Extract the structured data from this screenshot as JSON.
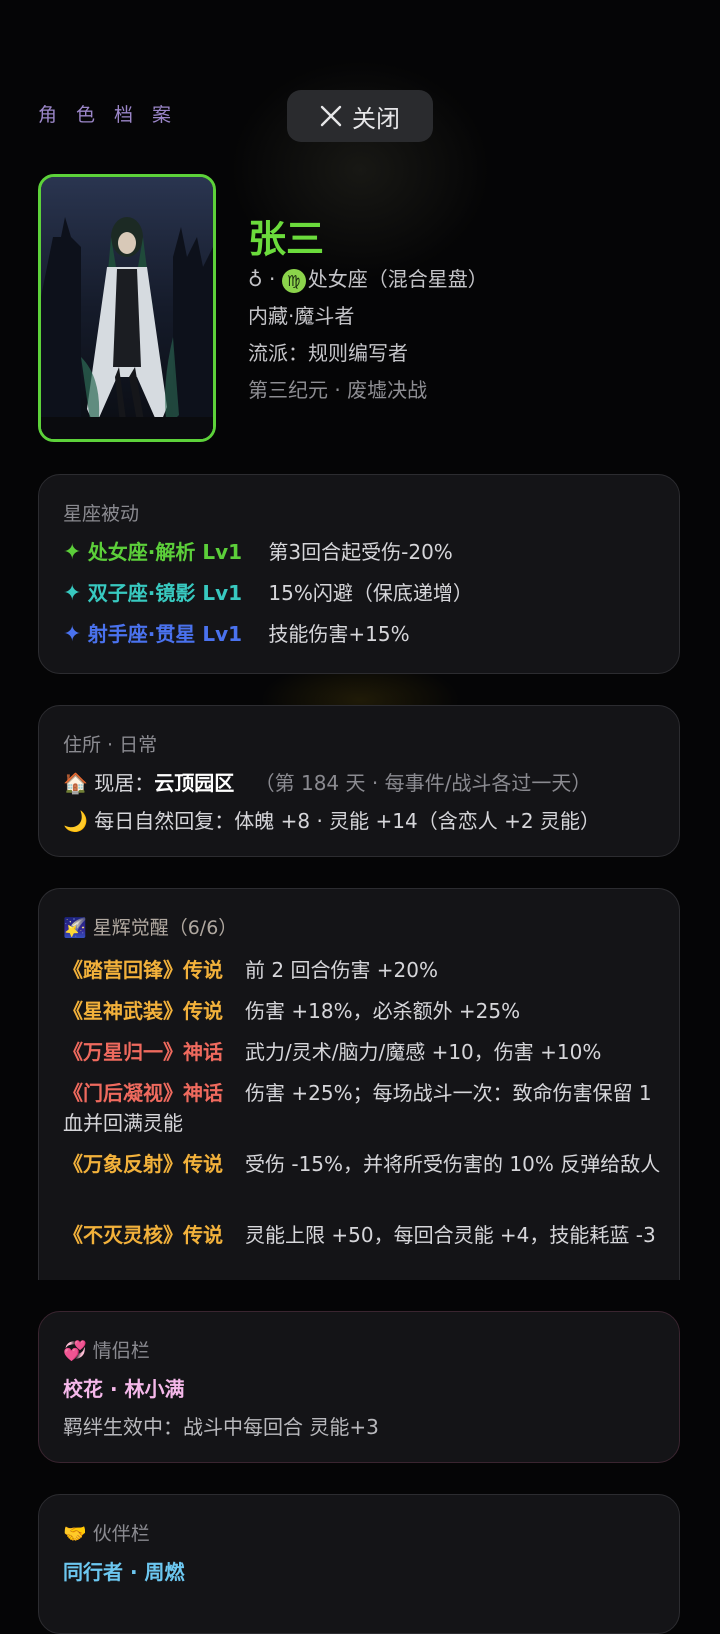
{
  "header": {
    "page_label": "角色档案",
    "close_label": "关闭"
  },
  "profile": {
    "name": "张三",
    "gender_sep": "♁ · ",
    "zodiac_symbol": "♍",
    "zodiac": "处女座（混合星盘）",
    "hidden_trait": "内藏·魔斗者",
    "school": "流派：规则编写者",
    "era": "第三纪元 · 废墟决战"
  },
  "constellation": {
    "title": "星座被动",
    "items": [
      {
        "icon": "✦",
        "name": "处女座·解析 Lv1",
        "desc": "第3回合起受伤-20%",
        "color": "#5ccf3a"
      },
      {
        "icon": "✦",
        "name": "双子座·镜影 Lv1",
        "desc": "15%闪避（保底递增）",
        "color": "#38c9c0"
      },
      {
        "icon": "✦",
        "name": "射手座·贯星 Lv1",
        "desc": "技能伤害+15%",
        "color": "#4a72ee"
      }
    ]
  },
  "residence": {
    "title": "住所 · 日常",
    "home_icon": "🏠",
    "home_label": "现居：",
    "home_name": "云顶园区",
    "home_note": "（第 184 天 · 每事件/战斗各过一天）",
    "moon_icon": "🌙",
    "regen": "每日自然回复：体魄 +8 · 灵能 +14（含恋人 +2 灵能）"
  },
  "awakening": {
    "icon": "🌠",
    "title": "星辉觉醒（6/6）",
    "items": [
      {
        "name": "《踏营回锋》传说",
        "desc": "前 2 回合伤害 +20%",
        "tier": "gold"
      },
      {
        "name": "《星神武装》传说",
        "desc": "伤害 +18%，必杀额外 +25%",
        "tier": "gold"
      },
      {
        "name": "《万星归一》神话",
        "desc": "武力/灵术/脑力/魔感 +10，伤害 +10%",
        "tier": "red"
      },
      {
        "name": "《门后凝视》神话",
        "desc": "伤害 +25%；每场战斗一次：致命伤害保留 1 血并回满灵能",
        "tier": "red"
      },
      {
        "name": "《万象反射》传说",
        "desc": "受伤 -15%，并将所受伤害的 10% 反弹给敌人",
        "tier": "gold"
      },
      {
        "name": "《不灭灵核》传说",
        "desc": "灵能上限 +50，每回合灵能 +4，技能耗蓝 -3",
        "tier": "gold"
      }
    ]
  },
  "lover": {
    "icon": "💞",
    "title": "情侣栏",
    "name": "校花 · 林小满",
    "bond": "羁绊生效中：战斗中每回合 灵能+3"
  },
  "partner": {
    "icon": "🤝",
    "title": "伙伴栏",
    "name": "同行者 · 周燃"
  },
  "colors": {
    "accent_green": "#6bdb3c",
    "gold": "#f2b13b",
    "red": "#ef6a5e",
    "lover_name": "#f5b8ea",
    "partner_name": "#6cc7f0",
    "title_purple": "#9b86c8"
  }
}
